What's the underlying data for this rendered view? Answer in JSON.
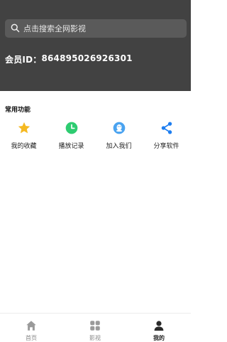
{
  "search": {
    "placeholder": "点击搜索全网影视",
    "icon": "search-icon"
  },
  "member": {
    "label": "会员ID：",
    "id": "864895026926301"
  },
  "section": {
    "title": "常用功能"
  },
  "functions": [
    {
      "label": "我的收藏",
      "icon": "star-icon",
      "color": "#f5b921"
    },
    {
      "label": "播放记录",
      "icon": "clock-icon",
      "color": "#2ecc71"
    },
    {
      "label": "加入我们",
      "icon": "qq-icon",
      "color": "#4aa3f0"
    },
    {
      "label": "分享软件",
      "icon": "share-icon",
      "color": "#1e7ef0"
    }
  ],
  "tabs": [
    {
      "label": "首页",
      "icon": "home-icon",
      "active": false
    },
    {
      "label": "影视",
      "icon": "grid-icon",
      "active": false
    },
    {
      "label": "我的",
      "icon": "user-icon",
      "active": true
    }
  ],
  "colors": {
    "header_bg": "#424242",
    "search_bg": "#5a5a5a"
  }
}
